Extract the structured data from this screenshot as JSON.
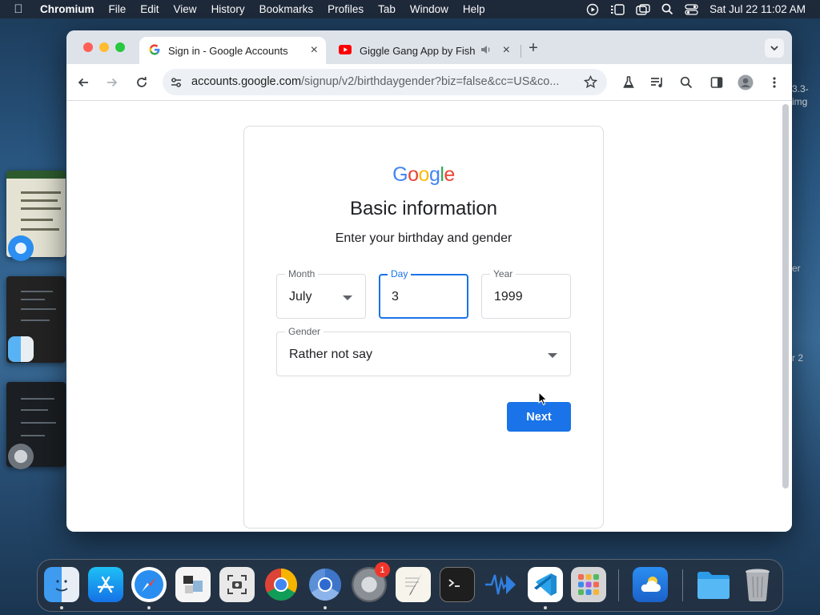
{
  "menubar": {
    "app_name": "Chromium",
    "items": [
      "File",
      "Edit",
      "View",
      "History",
      "Bookmarks",
      "Profiles",
      "Tab",
      "Window",
      "Help"
    ],
    "clock": "Sat Jul 22  11:02 AM"
  },
  "desktop": {
    "labels": [
      "3.3-",
      "img",
      "er",
      "r 2"
    ]
  },
  "browser": {
    "tabs": [
      {
        "title": "Sign in - Google Accounts",
        "icon": "google-g-icon",
        "active": true
      },
      {
        "title": "Giggle Gang App by Fish",
        "icon": "youtube-icon",
        "active": false,
        "audio": true
      }
    ],
    "new_tab_label": "+",
    "address": {
      "host": "accounts.google.com",
      "path": "/signup/v2/birthdaygender?biz=false&cc=US&co..."
    }
  },
  "page": {
    "logo_text": "Google",
    "logo_colors": [
      "#4285F4",
      "#EA4335",
      "#FBBC05",
      "#4285F4",
      "#34A853",
      "#EA4335"
    ],
    "title": "Basic information",
    "subtitle": "Enter your birthday and gender",
    "month": {
      "label": "Month",
      "value": "July"
    },
    "day": {
      "label": "Day",
      "value": "3"
    },
    "year": {
      "label": "Year",
      "value": "1999"
    },
    "gender": {
      "label": "Gender",
      "value": "Rather not say"
    },
    "next_label": "Next",
    "accent_color": "#1a73e8"
  },
  "dock": {
    "apps": [
      "finder",
      "app-store",
      "safari",
      "preview",
      "screenshot",
      "chrome",
      "chromium",
      "system-settings",
      "textedit",
      "terminal",
      "xcode-instruments",
      "vscode",
      "launchpad",
      "weather",
      "downloads-folder",
      "trash"
    ],
    "system_settings_badge": "1"
  }
}
